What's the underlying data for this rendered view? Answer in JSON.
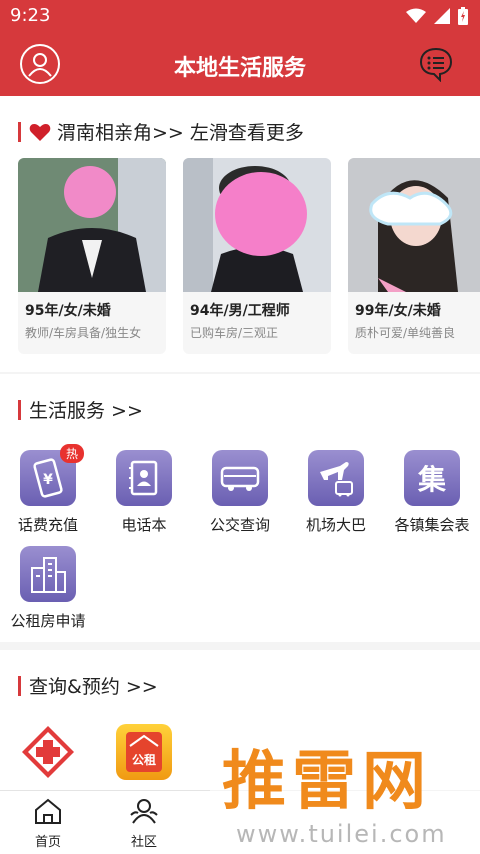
{
  "status_bar": {
    "time": "9:23"
  },
  "header": {
    "title": "本地生活服务",
    "avatar_icon": "user-circle-icon",
    "message_icon": "chat-bubble-icon"
  },
  "matchmaking": {
    "title": "渭南相亲角>> 左滑查看更多",
    "profiles": [
      {
        "main": "95年/女/未婚",
        "sub": "教师/车房具备/独生女"
      },
      {
        "main": "94年/男/工程师",
        "sub": "已购车房/三观正"
      },
      {
        "main": "99年/女/未婚",
        "sub": "质朴可爱/单纯善良"
      }
    ]
  },
  "life_services": {
    "title": "生活服务 >>",
    "items": [
      {
        "label": "话费充值",
        "icon": "phone-yuan-icon",
        "badge": "热"
      },
      {
        "label": "电话本",
        "icon": "address-book-icon"
      },
      {
        "label": "公交查询",
        "icon": "bus-icon"
      },
      {
        "label": "机场大巴",
        "icon": "airport-bus-icon"
      },
      {
        "label": "各镇集会表",
        "icon": "market-ji-icon",
        "glyph": "集"
      },
      {
        "label": "公租房申请",
        "icon": "buildings-icon"
      }
    ]
  },
  "query": {
    "title": "查询&预约 >>",
    "items": [
      {
        "icon": "red-cross-icon"
      },
      {
        "icon": "public-rental-icon",
        "glyph": "公租"
      }
    ]
  },
  "bottom_nav": [
    {
      "label": "首页",
      "icon": "home-icon"
    },
    {
      "label": "社区",
      "icon": "community-icon"
    }
  ],
  "watermark": {
    "text": "推雷网",
    "url": "www.tuilei.com"
  },
  "colors": {
    "brand": "#d6393c",
    "icon_purple": "#7a6fbf",
    "watermark": "#f08a1c"
  }
}
